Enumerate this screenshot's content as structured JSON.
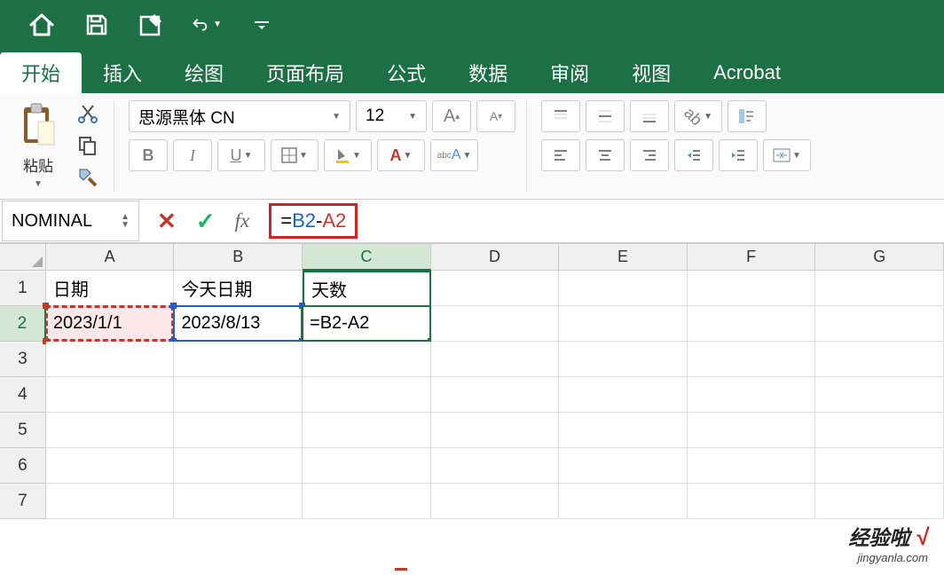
{
  "titlebar": {
    "icons": [
      "home",
      "save",
      "edit",
      "undo",
      "overflow"
    ]
  },
  "tabs": [
    {
      "label": "开始",
      "active": true
    },
    {
      "label": "插入",
      "active": false
    },
    {
      "label": "绘图",
      "active": false
    },
    {
      "label": "页面布局",
      "active": false
    },
    {
      "label": "公式",
      "active": false
    },
    {
      "label": "数据",
      "active": false
    },
    {
      "label": "审阅",
      "active": false
    },
    {
      "label": "视图",
      "active": false
    },
    {
      "label": "Acrobat",
      "active": false
    }
  ],
  "ribbon": {
    "paste_label": "粘贴",
    "font_name": "思源黑体 CN",
    "font_size": "12"
  },
  "formula_bar": {
    "name_box": "NOMINAL",
    "fx_label": "fx",
    "formula_eq": "=",
    "formula_ref1": "B2",
    "formula_op": "-",
    "formula_ref2": "A2"
  },
  "columns": [
    "A",
    "B",
    "C",
    "D",
    "E",
    "F",
    "G"
  ],
  "rows": [
    "1",
    "2",
    "3",
    "4",
    "5",
    "6",
    "7"
  ],
  "cells": {
    "A1": "日期",
    "B1": "今天日期",
    "C1": "天数",
    "A2": "2023/1/1",
    "B2": "2023/8/13",
    "C2": "=B2-A2"
  },
  "watermark": {
    "main": "经验啦",
    "check": "√",
    "sub": "jingyanla.com"
  }
}
